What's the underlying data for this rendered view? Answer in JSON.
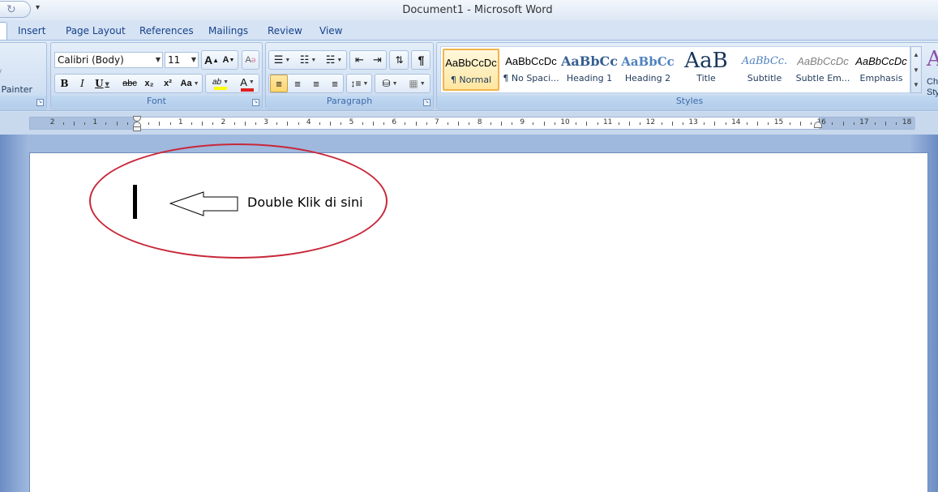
{
  "window": {
    "title": "Document1 - Microsoft Word"
  },
  "tabs": [
    "Insert",
    "Page Layout",
    "References",
    "Mailings",
    "Review",
    "View"
  ],
  "clipboard": {
    "format_painter_label": "at Painter"
  },
  "font": {
    "name": "Calibri (Body)",
    "size": "11",
    "group_label": "Font",
    "grow_label": "A",
    "shrink_label": "A",
    "clear_label": "A",
    "bold": "B",
    "italic": "I",
    "underline": "U",
    "strike": "abc",
    "subscript": "x₂",
    "superscript": "x²",
    "case": "Aa",
    "highlight": "ab",
    "color": "A",
    "highlight_color": "#ffff00",
    "font_color": "#e02020"
  },
  "paragraph": {
    "group_label": "Paragraph",
    "pilcrow": "¶"
  },
  "styles": {
    "group_label": "Styles",
    "items": [
      {
        "preview": "AaBbCcDc",
        "name": "¶ Normal"
      },
      {
        "preview": "AaBbCcDc",
        "name": "¶ No Spaci..."
      },
      {
        "preview": "AaBbCc",
        "name": "Heading 1"
      },
      {
        "preview": "AaBbCc",
        "name": "Heading 2"
      },
      {
        "preview": "AaB",
        "name": "Title"
      },
      {
        "preview": "AaBbCc.",
        "name": "Subtitle"
      },
      {
        "preview": "AaBbCcDc",
        "name": "Subtle Em..."
      },
      {
        "preview": "AaBbCcDc",
        "name": "Emphasis"
      }
    ],
    "change_styles_label_1": "Cha",
    "change_styles_label_2": "Sty"
  },
  "ruler": {
    "labels": [
      "2",
      "1",
      "1",
      "2",
      "3",
      "4",
      "5",
      "6",
      "7",
      "8",
      "9",
      "10",
      "11",
      "12",
      "13",
      "14",
      "15",
      "16",
      "17",
      "18"
    ]
  },
  "annotation": {
    "text": "Double Klik di sini",
    "color": "#c8283a"
  }
}
